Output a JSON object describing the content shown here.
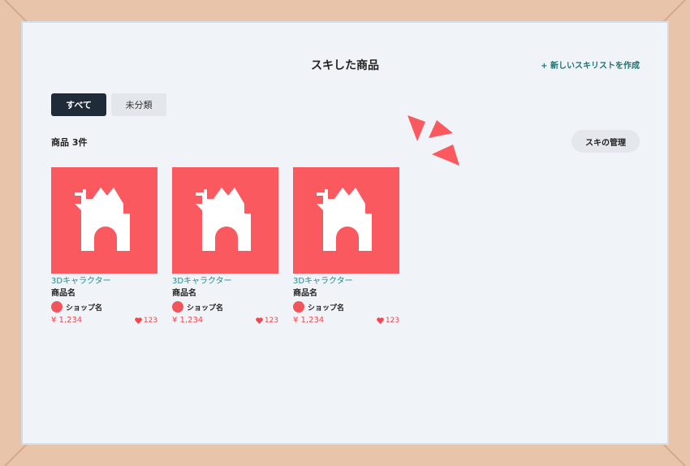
{
  "header": {
    "title": "スキした商品",
    "new_list_label": "+ 新しいスキリストを作成"
  },
  "tabs": [
    {
      "label": "すべて",
      "active": true
    },
    {
      "label": "未分類",
      "active": false
    }
  ],
  "summary": {
    "count_label": "商品 3件",
    "manage_label": "スキの管理"
  },
  "colors": {
    "accent": "#fa5a5f",
    "teal": "#2a8a8c",
    "dark": "#202b3a"
  },
  "products": [
    {
      "category": "3Dキャラクター",
      "name": "商品名",
      "shop": "ショップ名",
      "price": "¥ 1,234",
      "likes": "123"
    },
    {
      "category": "3Dキャラクター",
      "name": "商品名",
      "shop": "ショップ名",
      "price": "¥ 1,234",
      "likes": "123"
    },
    {
      "category": "3Dキャラクター",
      "name": "商品名",
      "shop": "ショップ名",
      "price": "¥ 1,234",
      "likes": "123"
    }
  ]
}
